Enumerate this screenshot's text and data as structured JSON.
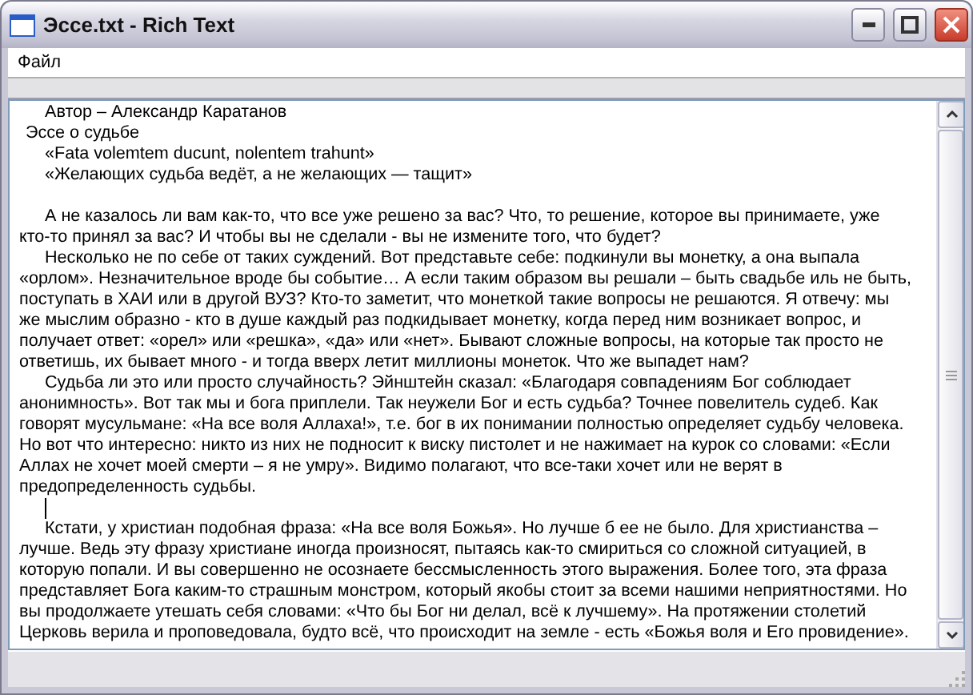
{
  "window": {
    "title": "Эссе.txt - Rich Text"
  },
  "menu": [
    "Файл"
  ],
  "document": {
    "lines": [
      {
        "kind": "indent",
        "text": "Автор – Александр Каратанов"
      },
      {
        "kind": "space",
        "text": "Эссе о судьбе"
      },
      {
        "kind": "indent",
        "text": "«Fata volemtem ducunt, nolentem trahunt»"
      },
      {
        "kind": "indent",
        "text": "«Желающих судьба ведёт, а не желающих — тащит»"
      },
      {
        "kind": "blank"
      },
      {
        "kind": "indent",
        "text": "А не казалось ли вам как-то, что все уже решено за вас? Что, то решение, которое вы принимаете, уже"
      },
      {
        "kind": "plain",
        "text": "кто-то принял за вас? И чтобы вы не сделали - вы не измените того, что будет?"
      },
      {
        "kind": "indent",
        "text": "Несколько не по себе от таких суждений. Вот представьте себе: подкинули вы монетку, а она выпала"
      },
      {
        "kind": "plain",
        "text": "«орлом». Незначительное вроде бы событие… А если таким образом вы решали – быть свадьбе иль не быть,"
      },
      {
        "kind": "plain",
        "text": "поступать в ХАИ или в другой ВУЗ? Кто-то заметит, что монеткой такие вопросы не решаются. Я отвечу: мы"
      },
      {
        "kind": "plain",
        "text": "же мыслим образно - кто в душе каждый раз подкидывает монетку, когда перед ним возникает вопрос, и"
      },
      {
        "kind": "plain",
        "text": "получает ответ: «орел» или «решка», «да» или «нет». Бывают сложные вопросы, на которые так просто не"
      },
      {
        "kind": "plain",
        "text": "ответишь, их бывает много - и тогда вверх летит миллионы монеток. Что же выпадет нам?"
      },
      {
        "kind": "indent",
        "text": "Судьба ли это или просто случайность? Эйнштейн сказал: «Благодаря совпадениям Бог соблюдает"
      },
      {
        "kind": "plain",
        "text": "анонимность». Вот так мы и бога приплели. Так неужели Бог и есть судьба? Точнее повелитель судеб. Как"
      },
      {
        "kind": "plain",
        "text": "говорят мусульмане: «На все воля Аллаха!», т.е. бог в их понимании полностью определяет судьбу человека."
      },
      {
        "kind": "plain",
        "text": "Но вот что интересно: никто из них не подносит к виску пистолет и не нажимает на курок со словами: «Если"
      },
      {
        "kind": "plain",
        "text": "Аллах не хочет моей смерти – я не умру». Видимо полагают, что все-таки хочет или не верят в"
      },
      {
        "kind": "plain",
        "text": "предопределенность судьбы."
      },
      {
        "kind": "cursor"
      },
      {
        "kind": "indent",
        "text": "Кстати, у христиан подобная фраза: «На все воля Божья». Но лучше б ее не было. Для христианства –"
      },
      {
        "kind": "plain",
        "text": "лучше. Ведь эту фразу христиане иногда произносят, пытаясь как-то смириться со сложной ситуацией, в"
      },
      {
        "kind": "plain",
        "text": "которую попали. И вы совершенно не осознаете бессмысленность этого выражения. Более того, эта фраза"
      },
      {
        "kind": "plain",
        "text": "представляет Бога каким-то страшным монстром, который якобы стоит за всеми нашими неприятностями. Но"
      },
      {
        "kind": "plain",
        "text": "вы продолжаете утешать себя словами: «Что бы Бог ни делал, всё к лучшему». На протяжении столетий"
      },
      {
        "kind": "plain",
        "text": "Церковь верила и проповедовала, будто всё, что происходит на земле - есть «Божья воля и Его провидение»."
      }
    ]
  }
}
